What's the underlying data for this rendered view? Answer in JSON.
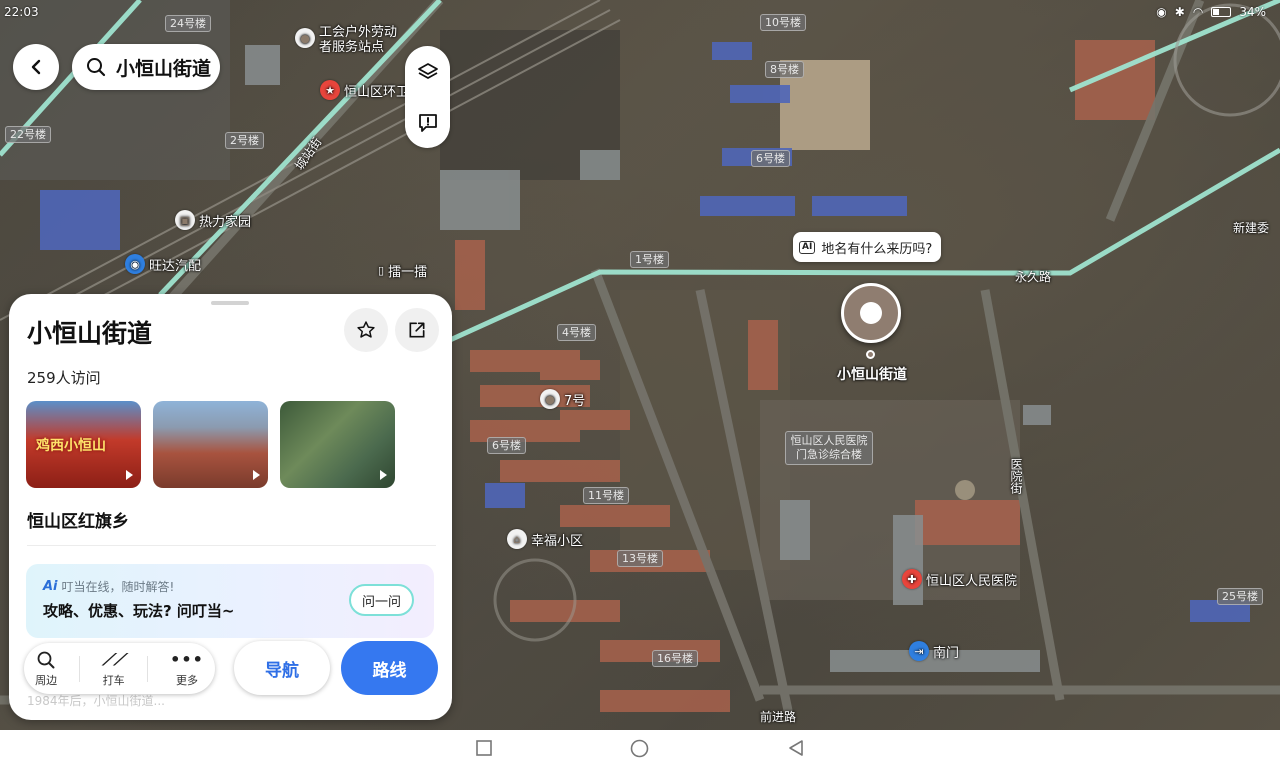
{
  "status_bar": {
    "time": "22:03",
    "battery": "34%"
  },
  "search": {
    "query": "小恒山街道"
  },
  "map": {
    "building_tags": [
      "24号楼",
      "22号楼",
      "2号楼",
      "10号楼",
      "8号楼",
      "6号楼",
      "1号楼",
      "4号楼",
      "6号楼",
      "11号楼",
      "13号楼",
      "16号楼",
      "25号楼"
    ],
    "pois": {
      "union_station": "工会户外劳动者服务站点",
      "env_office": "恒山区环卫管理处",
      "heating": "热力家园",
      "wangda": "旺达汽配",
      "qiyi": "擂一擂",
      "no7": "7号",
      "xingfu": "幸福小区",
      "hospital": "恒山区人民医院",
      "south_gate": "南门",
      "hospital_building": "恒山区人民医院门急诊综合楼"
    },
    "roads": {
      "chengzhan": "城站街",
      "yongjiu": "永久路",
      "yiyuan": "医院街",
      "qianjin": "前进路"
    },
    "edge_label": "新建委",
    "ai_bubble": "地名有什么来历吗?",
    "ai_bubble_mark": "AI",
    "pin_label": "小恒山街道"
  },
  "place": {
    "title": "小恒山街道",
    "visits": "259人访问",
    "admin_area": "恒山区红旗乡",
    "thumb1_caption": "鸡西小恒山",
    "ai_card": {
      "logo": "Ai",
      "hint": "叮当在线，随时解答!",
      "main": "攻略、优惠、玩法? 问叮当~",
      "ask_button": "问一问"
    },
    "faded_text": "1984年后，小恒山街道..."
  },
  "actions": {
    "nearby": "周边",
    "taxi": "打车",
    "more": "更多",
    "navigate": "导航",
    "route": "路线"
  },
  "colors": {
    "accent": "#3578f0",
    "road_highlight": "#9fe3cf",
    "pin": "#8f7d70",
    "hospital": "#e8453c"
  }
}
